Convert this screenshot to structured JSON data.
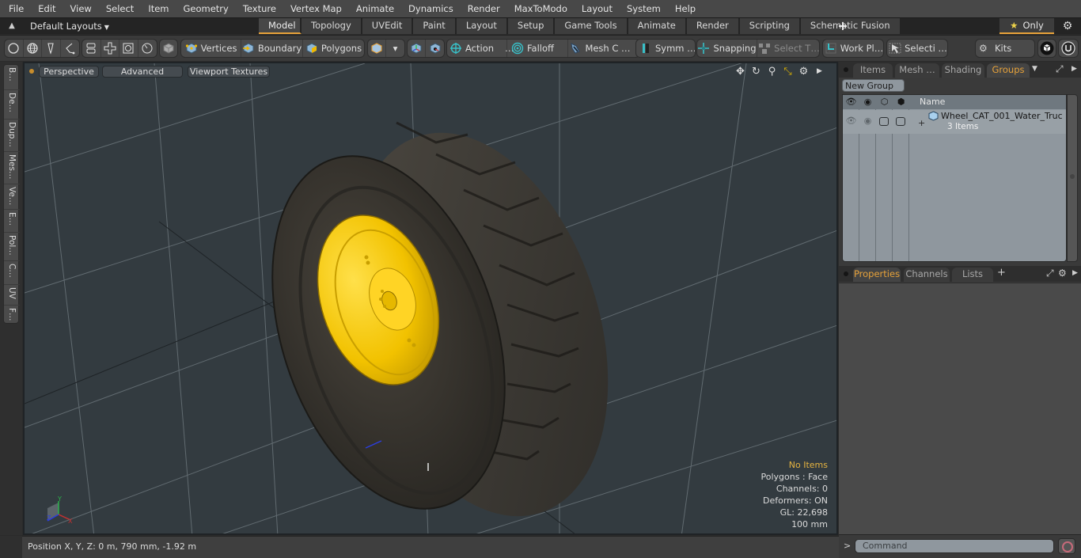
{
  "menubar": {
    "items": [
      "File",
      "Edit",
      "View",
      "Select",
      "Item",
      "Geometry",
      "Texture",
      "Vertex Map",
      "Animate",
      "Dynamics",
      "Render",
      "MaxToModo",
      "Layout",
      "System",
      "Help"
    ]
  },
  "layoutbar": {
    "layouts_dropdown": "Default Layouts",
    "tabs": [
      "Model",
      "Topology",
      "UVEdit",
      "Paint",
      "Layout",
      "Setup",
      "Game Tools",
      "Animate",
      "Render",
      "Scripting",
      "Schematic Fusion"
    ],
    "active_tab": "Model",
    "add_tab_label": "+",
    "only_label": "Only"
  },
  "toolbar": {
    "vertices": "Vertices",
    "boundary": "Boundary",
    "polygons": "Polygons",
    "action": "Action",
    "action_more": "…",
    "falloff": "Falloff",
    "mesh_c": "Mesh C …",
    "symm": "Symm …",
    "snapping": "Snapping",
    "select_t": "Select T…",
    "work_pl": "Work Pl…",
    "selecti": "Selecti …",
    "kits": "Kits"
  },
  "leftstrip": {
    "tabs": [
      "B…",
      "De…",
      "Dup…",
      "Mes…",
      "Ve…",
      "E…",
      "Pol…",
      "C…",
      "UV",
      "F…"
    ]
  },
  "viewport": {
    "view_mode": "Perspective",
    "shading": "Advanced",
    "textures": "Viewport Textures",
    "info": {
      "selection": "No Items",
      "polygons": "Polygons : Face",
      "channels": "Channels: 0",
      "deformers": "Deformers: ON",
      "gl": "GL: 22,698",
      "scale": "100 mm"
    },
    "axis_labels": {
      "x": "X",
      "y": "Y",
      "z": "Z"
    }
  },
  "statusbar": {
    "position": "Position X, Y, Z:   0 m, 790 mm, -1.92 m"
  },
  "groups_panel": {
    "tabs": [
      "Items",
      "Mesh …",
      "Shading",
      "Groups"
    ],
    "active_tab": "Groups",
    "new_group": "New Group",
    "column_name": "Name",
    "rows": [
      {
        "name": "Wheel_CAT_001_Water_Truc …",
        "count": "3 Items"
      }
    ]
  },
  "properties_panel": {
    "tabs": [
      "Properties",
      "Channels",
      "Lists"
    ],
    "active_tab": "Properties",
    "add_tab_label": "+"
  },
  "command": {
    "prompt": ">",
    "placeholder": "Command"
  },
  "colors": {
    "accent": "#e7a23a",
    "rim_yellow": "#f2c200",
    "viewport_bg": "#333b40",
    "info_highlight": "#e6b440"
  }
}
